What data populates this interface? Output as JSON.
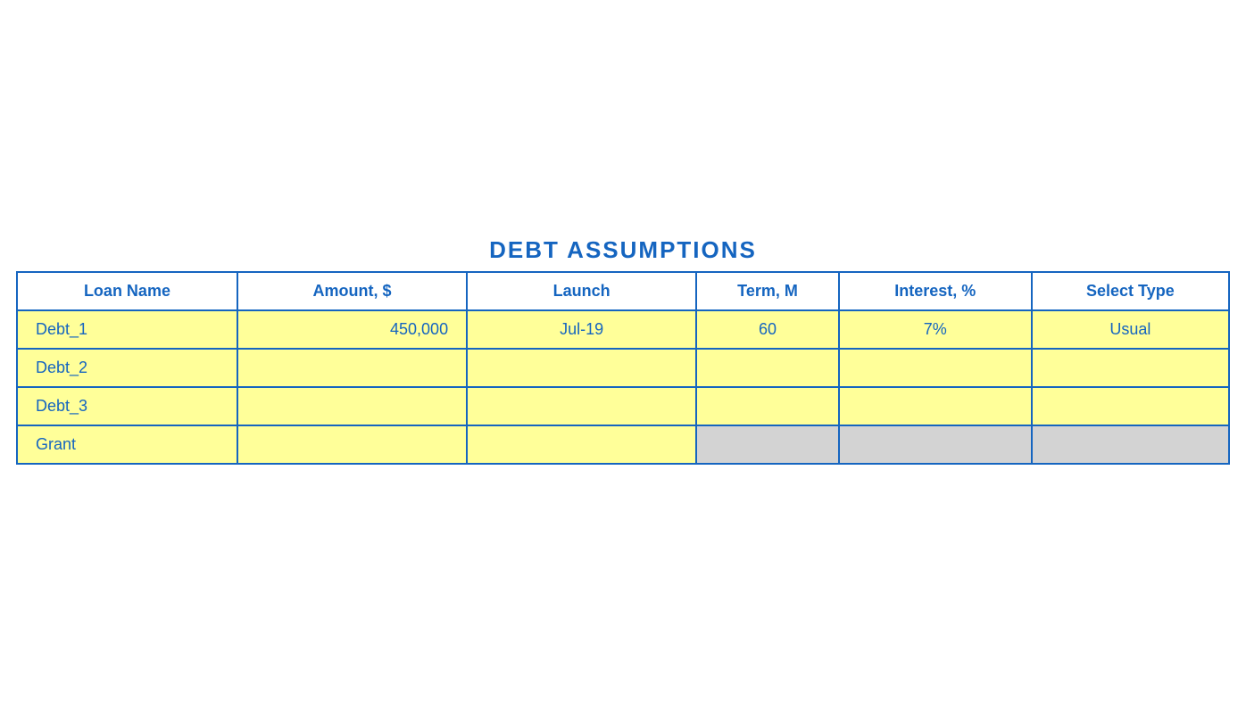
{
  "title": "DEBT ASSUMPTIONS",
  "table": {
    "headers": {
      "loan_name": "Loan Name",
      "amount": "Amount, $",
      "launch": "Launch",
      "term": "Term, M",
      "interest": "Interest, %",
      "select_type": "Select Type"
    },
    "rows": [
      {
        "loan_name": "Debt_1",
        "amount": "450,000",
        "launch": "Jul-19",
        "term": "60",
        "interest": "7%",
        "select_type": "Usual",
        "term_bg": "yellow",
        "interest_bg": "yellow",
        "type_bg": "yellow"
      },
      {
        "loan_name": "Debt_2",
        "amount": "",
        "launch": "",
        "term": "",
        "interest": "",
        "select_type": "",
        "term_bg": "yellow",
        "interest_bg": "yellow",
        "type_bg": "yellow"
      },
      {
        "loan_name": "Debt_3",
        "amount": "",
        "launch": "",
        "term": "",
        "interest": "",
        "select_type": "",
        "term_bg": "yellow",
        "interest_bg": "yellow",
        "type_bg": "yellow"
      },
      {
        "loan_name": "Grant",
        "amount": "",
        "launch": "",
        "term": "",
        "interest": "",
        "select_type": "",
        "term_bg": "gray",
        "interest_bg": "gray",
        "type_bg": "gray"
      }
    ]
  }
}
